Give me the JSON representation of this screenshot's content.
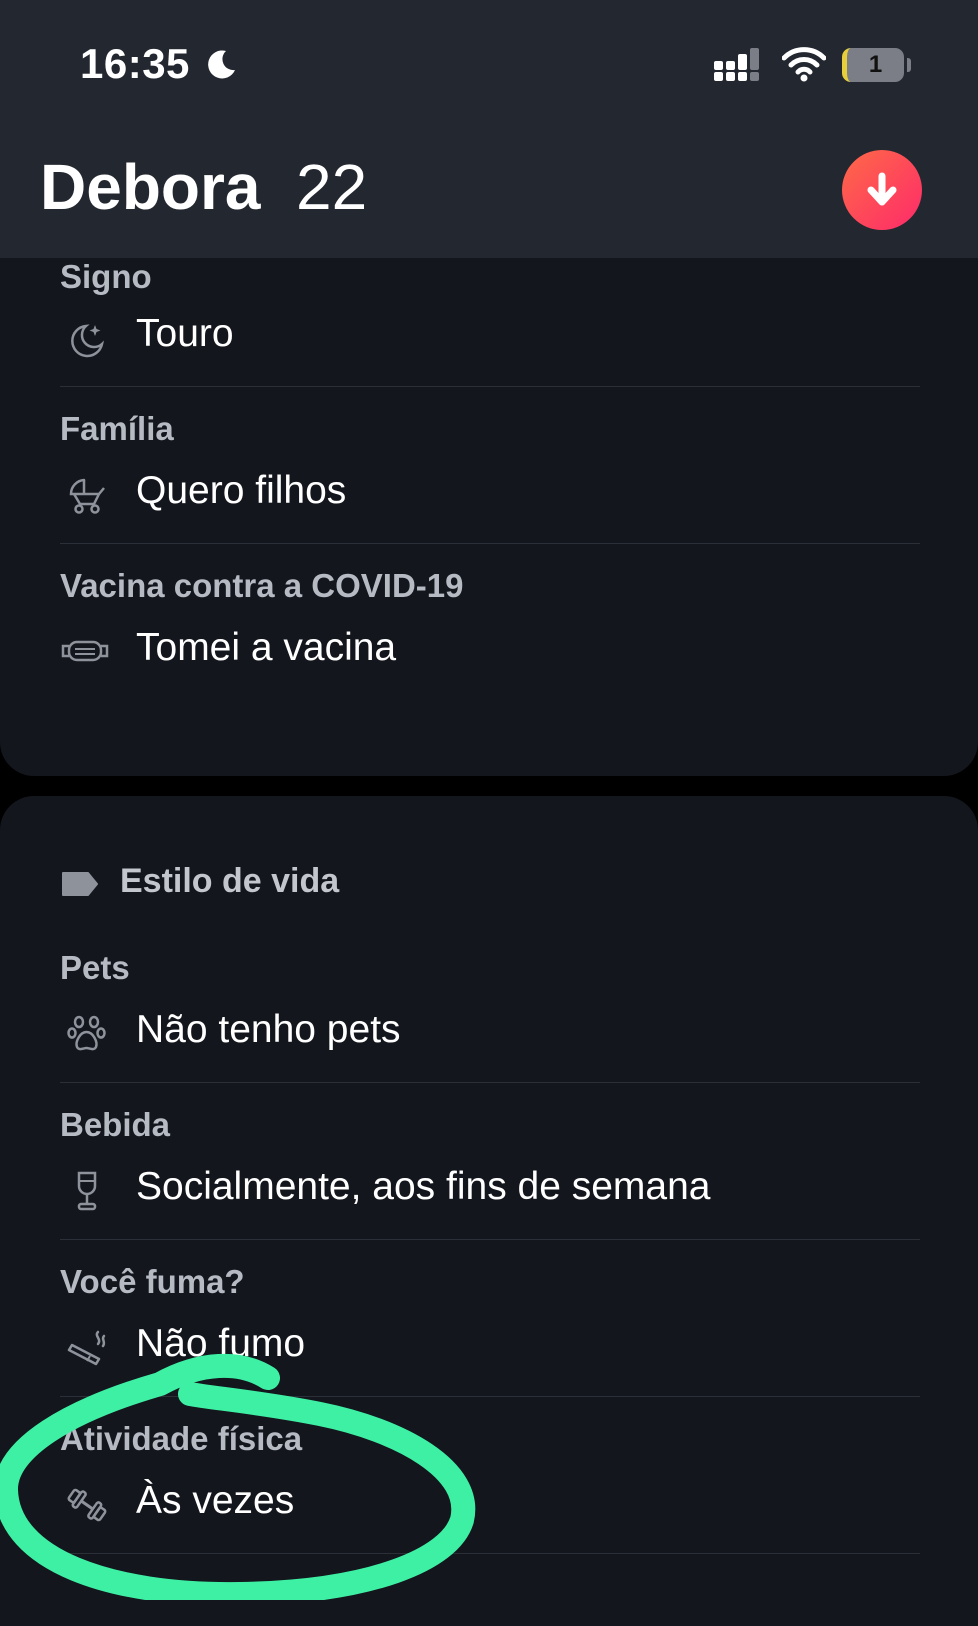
{
  "status_bar": {
    "time": "16:35",
    "battery": "1"
  },
  "header": {
    "name": "Debora",
    "age": "22"
  },
  "basics": [
    {
      "label": "Signo",
      "value": "Touro",
      "icon": "moon-stars-icon"
    },
    {
      "label": "Família",
      "value": "Quero filhos",
      "icon": "stroller-icon"
    },
    {
      "label": "Vacina contra a COVID-19",
      "value": "Tomei a vacina",
      "icon": "face-mask-icon"
    }
  ],
  "lifestyle": {
    "title": "Estilo de vida",
    "items": [
      {
        "label": "Pets",
        "value": "Não tenho pets",
        "icon": "paw-icon"
      },
      {
        "label": "Bebida",
        "value": "Socialmente, aos fins de semana",
        "icon": "wine-glass-icon"
      },
      {
        "label": "Você fuma?",
        "value": "Não fumo",
        "icon": "cigarette-icon"
      },
      {
        "label": "Atividade física",
        "value": "Às vezes",
        "icon": "dumbbell-icon"
      }
    ]
  },
  "colors": {
    "header_bg": "#232730",
    "card_bg": "#13161d",
    "accent_gradient_start": "#ff6a47",
    "accent_gradient_end": "#fd2a6a",
    "annotation": "#3ef0a4"
  }
}
